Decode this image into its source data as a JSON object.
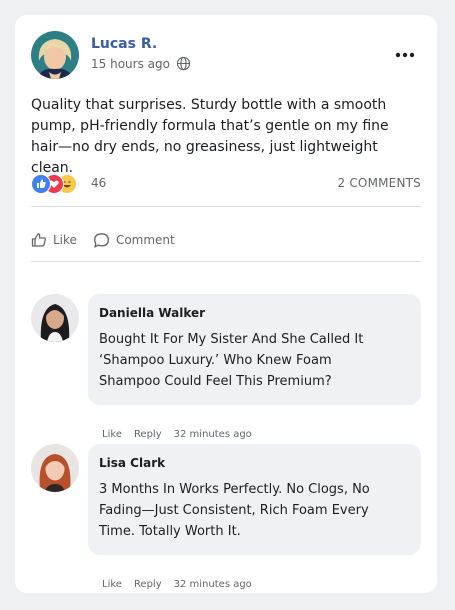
{
  "post": {
    "author": "Lucas R.",
    "time": "15 hours ago",
    "text": "Quality that surprises. Sturdy bottle with a smooth pump, pH-friendly formula that’s gentle on my fine hair—no dry ends, no greasiness, just lightweight clean.",
    "reaction_count": "46",
    "comments_count": "2 COMMENTS",
    "like_label": "Like",
    "comment_label": "Comment"
  },
  "comments": [
    {
      "name": "Daniella Walker",
      "text": "Bought It For My Sister And She Called It ‘Shampoo Luxury.’ Who Knew Foam Shampoo Could Feel This Premium?",
      "like": "Like",
      "reply": "Reply",
      "time": "32 minutes ago"
    },
    {
      "name": "Lisa Clark",
      "text": "3 Months In  Works Perfectly. No Clogs, No Fading—Just Consistent, Rich Foam Every Time. Totally Worth It.",
      "like": "Like",
      "reply": "Reply",
      "time": "32 minutes ago"
    }
  ],
  "colors": {
    "author": "#3b5ca8",
    "like_reaction": "#3f80f0",
    "love_reaction": "#f0384e",
    "haha_reaction": "#f7c948",
    "bubble": "#f0f1f4"
  },
  "icons": [
    "globe-icon",
    "more-options-icon",
    "like-reaction-icon",
    "love-reaction-icon",
    "haha-reaction-icon",
    "thumbs-up-icon",
    "comment-icon"
  ]
}
